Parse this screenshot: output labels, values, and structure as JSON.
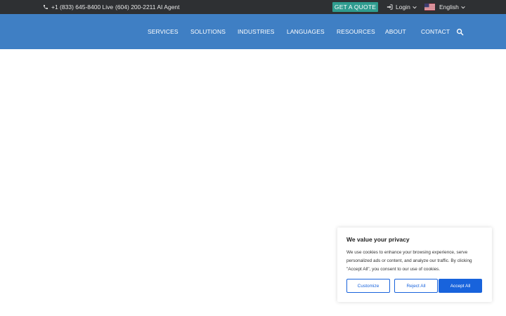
{
  "topbar": {
    "phone_live": "+1 (833) 645-8400 Live",
    "phone_ai": "(604) 200-2211 AI Agent",
    "quote_label": "GET A QUOTE",
    "login_label": "Login",
    "language_label": "English"
  },
  "nav": {
    "items": [
      "SERVICES",
      "SOLUTIONS",
      "INDUSTRIES",
      "LANGUAGES",
      "RESOURCES",
      "ABOUT",
      "CONTACT"
    ]
  },
  "cookie": {
    "title": "We value your privacy",
    "body": "We use cookies to enhance your browsing experience, serve personalized ads or content, and analyze our traffic. By clicking \"Accept All\", you consent to our use of cookies.",
    "customize_label": "Customize",
    "reject_label": "Reject All",
    "accept_label": "Accept All"
  },
  "colors": {
    "topbar_bg": "#2e3033",
    "nav_bg": "#3f7fc4",
    "quote_bg": "#2f9c8f",
    "cookie_accent": "#1863dc"
  },
  "icons": [
    "phone-icon",
    "login-icon",
    "chevron-down-icon",
    "us-flag-icon",
    "search-icon"
  ]
}
